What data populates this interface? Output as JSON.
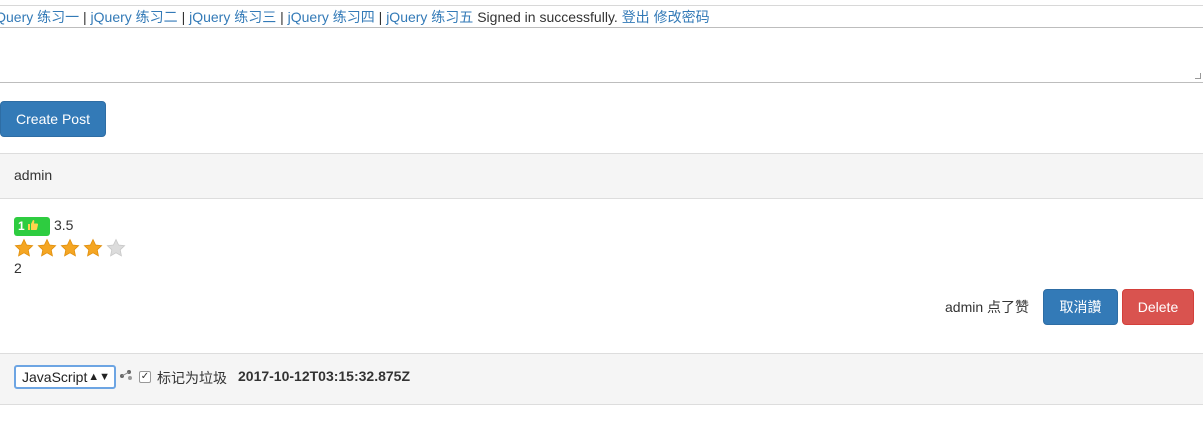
{
  "nav": {
    "links": [
      "jQuery 练习一",
      "jQuery 练习二",
      "jQuery 练习三",
      "jQuery 练习四",
      "jQuery 练习五"
    ],
    "separator": "|",
    "status_text": "Signed in successfully.",
    "logout_label": "登出",
    "change_password_label": "修改密码"
  },
  "composer": {
    "text": "",
    "create_button_label": "Create Post"
  },
  "post": {
    "author": "admin",
    "like_badge": "1",
    "like_icon": "thumbs-up-icon",
    "rating": "3.5",
    "stars": {
      "filled": 4,
      "total": 5
    },
    "count": "2",
    "liked_by_text": "admin 点了赞",
    "unlike_button_label": "取消讚",
    "delete_button_label": "Delete",
    "language_selected": "JavaScript",
    "spam_checked": true,
    "spam_label": "标记为垃圾",
    "timestamp": "2017-10-12T03:15:32.875Z"
  },
  "colors": {
    "primary": "#337ab7",
    "danger": "#d9534f",
    "badge": "#2ecc40",
    "star_on": "#f5a623",
    "star_off": "#dcdcdc",
    "panel_bg": "#f5f5f5"
  }
}
